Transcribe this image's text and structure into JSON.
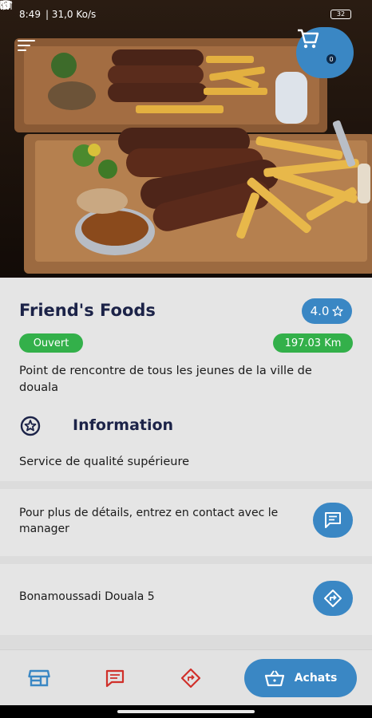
{
  "status_bar": {
    "time": "8:49",
    "network_speed": "| 31,0 Ko/s",
    "battery": "32",
    "left_icons": [
      "whatsapp-icon",
      "image-icon",
      "gmail-icon"
    ],
    "right_icons": [
      "bluetooth-icon",
      "signal-icon",
      "wifi-icon",
      "battery-icon"
    ]
  },
  "header": {
    "menu_icon": "menu-icon",
    "cart_icon": "cart-icon",
    "cart_count": "0"
  },
  "restaurant": {
    "name": "Friend's Foods",
    "rating": "4.0",
    "rating_icon": "star-icon",
    "status": "Ouvert",
    "distance": "197.03 Km",
    "description": "Point de rencontre de tous les jeunes de la ville de douala"
  },
  "information": {
    "icon": "star-badge-icon",
    "title": "Information",
    "service": "Service de qualité supérieure",
    "contact": "Pour plus de détails, entrez en contact avec le manager",
    "contact_icon": "message-icon",
    "address": "Bonamoussadi Douala 5",
    "directions_icon": "directions-icon"
  },
  "bottom_nav": {
    "items": [
      {
        "icon": "store-icon",
        "color": "#3a87c4"
      },
      {
        "icon": "message-icon",
        "color": "#d0302a"
      },
      {
        "icon": "directions-icon",
        "color": "#d0302a"
      }
    ],
    "achats_label": "Achats",
    "achats_icon": "basket-icon"
  },
  "colors": {
    "accent": "#3a87c4",
    "open_green": "#33b04a",
    "title_navy": "#1c2348",
    "nav_red": "#d0302a"
  }
}
